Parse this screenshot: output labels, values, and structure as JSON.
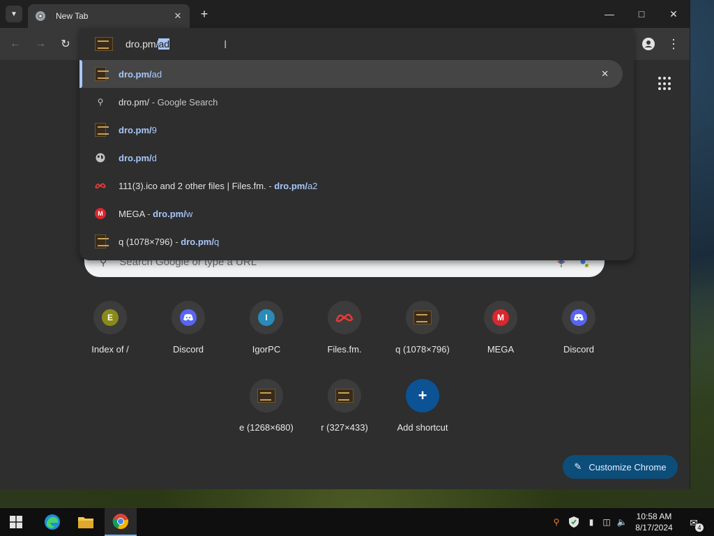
{
  "tab": {
    "title": "New Tab"
  },
  "omnibox": {
    "typed_prefix": "dro.pm/",
    "selected_completion": "ad"
  },
  "suggestions": [
    {
      "icon": "site-thumbnail-icon",
      "bold": "dro.pm/",
      "rest": "ad",
      "sep": "",
      "url_bold": "",
      "url_rest": ""
    },
    {
      "icon": "search-icon",
      "bold": "",
      "rest": "dro.pm/",
      "sep": " - Google Search",
      "url_bold": "",
      "url_rest": ""
    },
    {
      "icon": "site-thumbnail-icon",
      "bold": "dro.pm/",
      "rest": "9",
      "sep": "",
      "url_bold": "",
      "url_rest": ""
    },
    {
      "icon": "globe-icon",
      "bold": "dro.pm/",
      "rest": "d",
      "sep": "",
      "url_bold": "",
      "url_rest": ""
    },
    {
      "icon": "filesfm-icon",
      "bold": "",
      "rest": "111(3).ico and 2 other files | Files.fm.",
      "sep": " - ",
      "url_bold": "dro.pm/",
      "url_rest": "a2"
    },
    {
      "icon": "mega-icon",
      "bold": "",
      "rest": "MEGA",
      "sep": " - ",
      "url_bold": "dro.pm/",
      "url_rest": "w"
    },
    {
      "icon": "site-thumbnail-icon",
      "bold": "",
      "rest": "q (1078×796)",
      "sep": " - ",
      "url_bold": "dro.pm/",
      "url_rest": "q"
    }
  ],
  "ntp": {
    "search_placeholder": "Search Google or type a URL",
    "shortcuts": [
      {
        "label": "Index of /",
        "badge": "E",
        "color": "#8a8a1a"
      },
      {
        "label": "Discord",
        "badge": "discord",
        "color": "#5865f2"
      },
      {
        "label": "IgorPC",
        "badge": "I",
        "color": "#2a8ab8"
      },
      {
        "label": "Files.fm.",
        "badge": "filesfm",
        "color": "#e53a3a"
      },
      {
        "label": "q (1078×796)",
        "badge": "thumb",
        "color": "#3a2b18"
      },
      {
        "label": "MEGA",
        "badge": "M",
        "color": "#d9272e"
      },
      {
        "label": "Discord",
        "badge": "discord",
        "color": "#5865f2"
      },
      {
        "label": "e (1268×680)",
        "badge": "thumb",
        "color": "#3a2b18"
      },
      {
        "label": "r (327×433)",
        "badge": "thumb",
        "color": "#3a2b18"
      },
      {
        "label": "Add shortcut",
        "badge": "+",
        "color": "#0b5394"
      }
    ],
    "customize_label": "Customize Chrome"
  },
  "taskbar": {
    "time": "10:58 AM",
    "date": "8/17/2024",
    "notification_count": "4"
  }
}
